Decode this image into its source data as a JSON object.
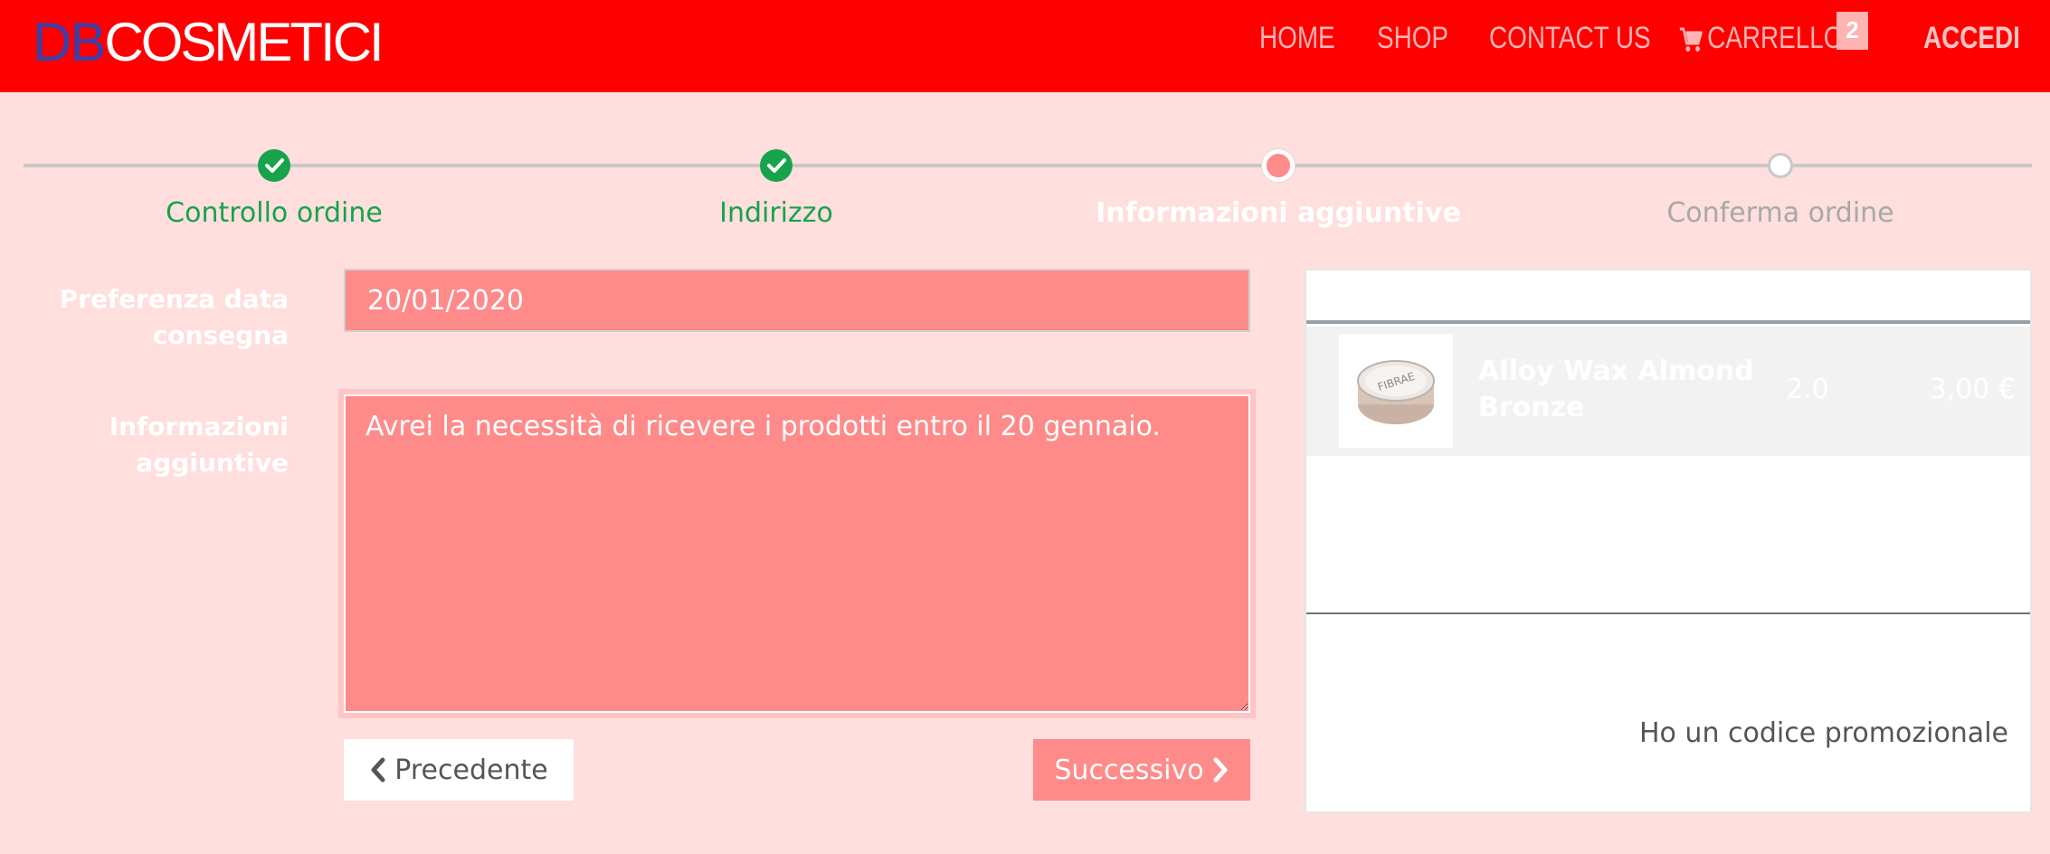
{
  "header": {
    "logo_part1": "DB",
    "logo_part2": "COSMETICI",
    "nav": {
      "home": "HOME",
      "shop": "SHOP",
      "contact": "CONTACT US",
      "cart": "CARRELLO",
      "cart_count": "2",
      "login": "ACCEDI"
    }
  },
  "steps": [
    {
      "label": "Controllo ordine",
      "state": "done"
    },
    {
      "label": "Indirizzo",
      "state": "done"
    },
    {
      "label": "Informazioni aggiuntive",
      "state": "current"
    },
    {
      "label": "Conferma ordine",
      "state": "todo"
    }
  ],
  "form": {
    "date_label_line1": "Preferenza data",
    "date_label_line2": "consegna",
    "date_value": "20/01/2020",
    "info_label_line1": "Informazioni",
    "info_label_line2": "aggiuntive",
    "info_value": "Avrei la necessità di ricevere i prodotti entro il 20 gennaio.",
    "prev_label": "Precedente",
    "next_label": "Successivo"
  },
  "summary": {
    "items": [
      {
        "name": "Alloy Wax Almond Bronze",
        "qty": "2.0",
        "price": "3,00 €",
        "thumb_text": "FIBRAE"
      }
    ],
    "promo_label": "Ho un codice promozionale"
  },
  "colors": {
    "header_bg": "#ff0000",
    "page_bg": "#ffdede",
    "accent": "#ff8a8a",
    "success": "#16a34a"
  }
}
